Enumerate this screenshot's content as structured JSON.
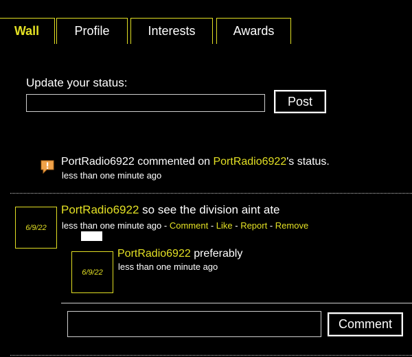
{
  "tabs": [
    {
      "label": "Wall",
      "active": true
    },
    {
      "label": "Profile",
      "active": false
    },
    {
      "label": "Interests",
      "active": false
    },
    {
      "label": "Awards",
      "active": false
    }
  ],
  "status": {
    "label": "Update your status:",
    "input_value": "",
    "post_label": "Post"
  },
  "notification": {
    "icon": "comment-bubble-icon",
    "user": "PortRadio6922",
    "mid_text": " commented on ",
    "target_user": "PortRadio6922",
    "end_text": "'s status.",
    "time": "less than one minute ago"
  },
  "post": {
    "avatar_text": "6/9/22",
    "user": "PortRadio6922",
    "text": " so see the division aint ate",
    "time": "less than one minute ago",
    "separator": " - ",
    "actions": [
      "Comment",
      "Like",
      "Report",
      "Remove"
    ]
  },
  "reply": {
    "avatar_text": "6/9/22",
    "user": "PortRadio6922",
    "text": " preferably",
    "time": "less than one minute ago"
  },
  "comment_box": {
    "input_value": "",
    "button_label": "Comment"
  },
  "colors": {
    "accent": "#e3e024",
    "background": "#000000",
    "text": "#ffffff",
    "icon_orange": "#f0a24a"
  }
}
